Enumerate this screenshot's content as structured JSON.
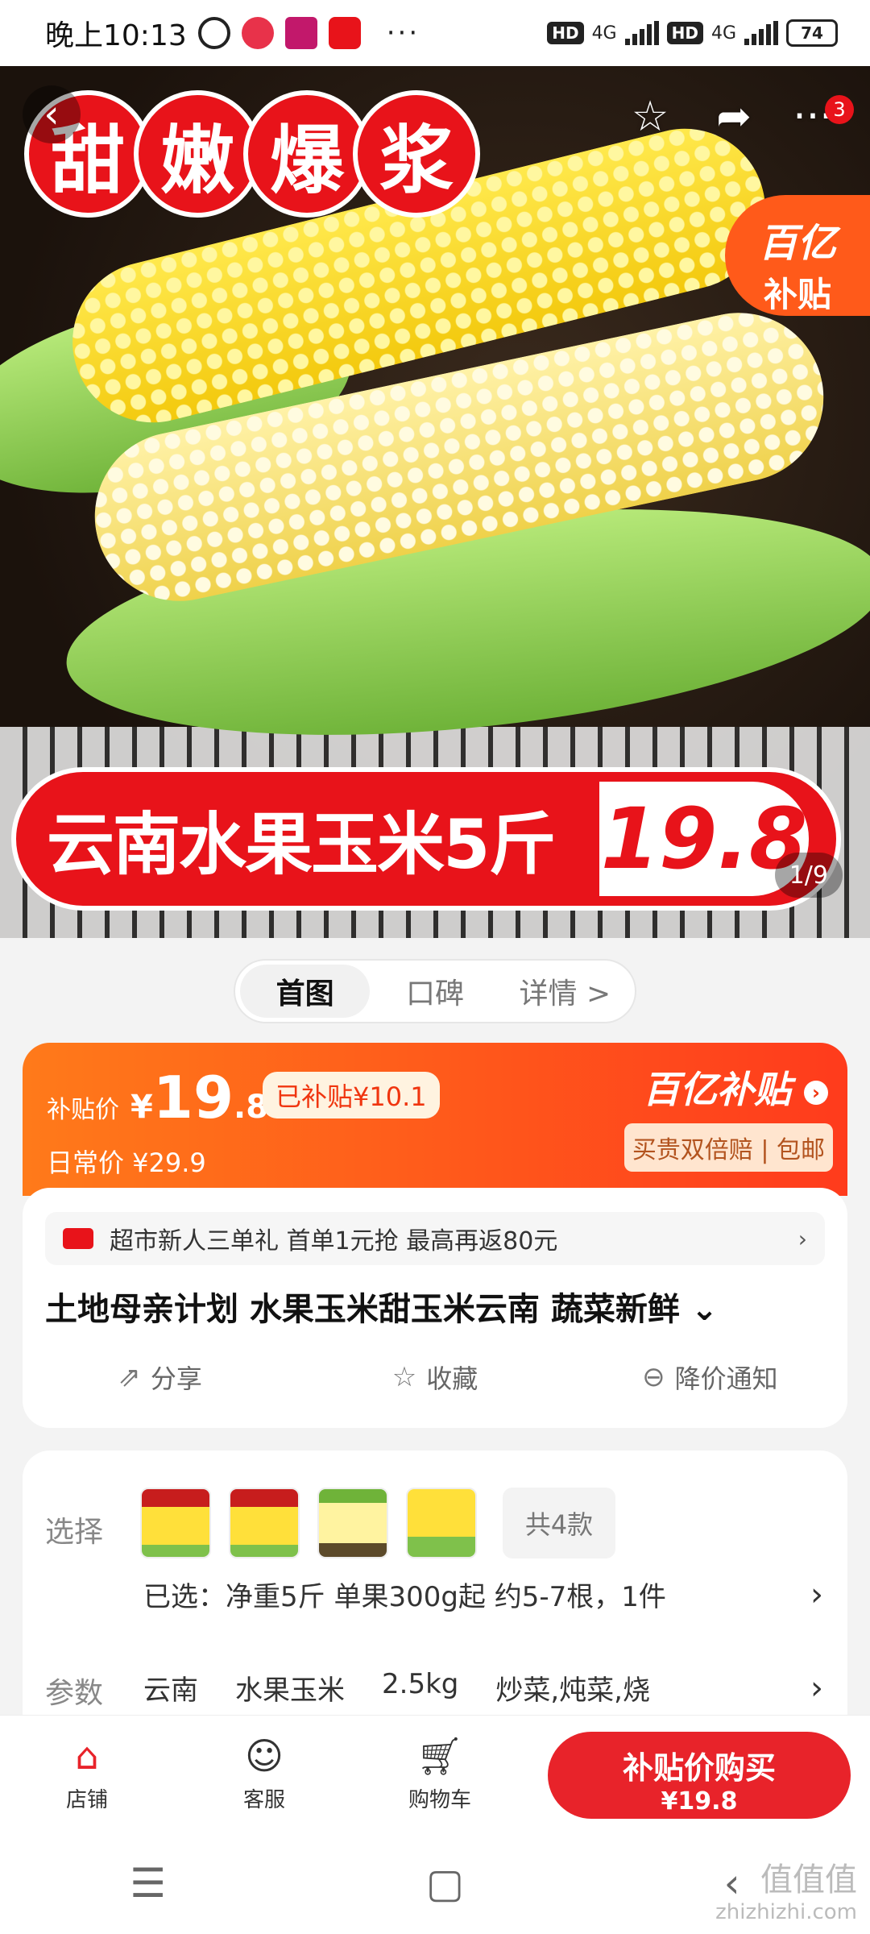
{
  "status_bar": {
    "time": "晚上10:13",
    "battery": "74",
    "network_1": "4G",
    "network_2": "4G",
    "hd": "HD",
    "more": "···"
  },
  "hero": {
    "banner_chars": [
      "甜",
      "嫩",
      "爆",
      "浆"
    ],
    "badge_line1": "百亿",
    "badge_line2": "补贴",
    "product_banner": "云南水果玉米5斤",
    "product_price": "19.8",
    "pager": "1/9",
    "notification_count": "3"
  },
  "tabs": [
    {
      "label": "首图",
      "active": true
    },
    {
      "label": "口碑",
      "active": false
    },
    {
      "label": "详情 >",
      "active": false
    }
  ],
  "price_card": {
    "label": "补贴价",
    "currency": "¥",
    "price_int": "19",
    "price_dec": ".8",
    "subsidy": "已补贴¥10.1",
    "daily": "日常价 ¥29.9",
    "brand": "百亿补贴",
    "guarantee": "买贵双倍赔 | 包邮"
  },
  "info_card": {
    "promo": "超市新人三单礼  首单1元抢  最高再返80元",
    "title": "土地母亲计划 水果玉米甜玉米云南 蔬菜新鲜",
    "actions": [
      {
        "label": "分享",
        "icon": "share-icon"
      },
      {
        "label": "收藏",
        "icon": "star-icon"
      },
      {
        "label": "降价通知",
        "icon": "price-drop-icon"
      }
    ]
  },
  "select_card": {
    "select_label": "选择",
    "count": "共4款",
    "selected": "已选：净重5斤 单果300g起  约5-7根，1件",
    "params_label": "参数",
    "params": [
      "云南",
      "水果玉米",
      "2.5kg",
      "炒菜,炖菜,烧"
    ]
  },
  "bottom_bar": {
    "shop": "店铺",
    "service": "客服",
    "cart": "购物车",
    "buy_line1": "补贴价购买",
    "buy_line2": "¥19.8"
  },
  "watermark": {
    "line1": "值值值",
    "line2": "zhizhizhi.com"
  },
  "colors": {
    "brand_red": "#e8131a",
    "subsidy_orange": "#ff5a1a"
  }
}
